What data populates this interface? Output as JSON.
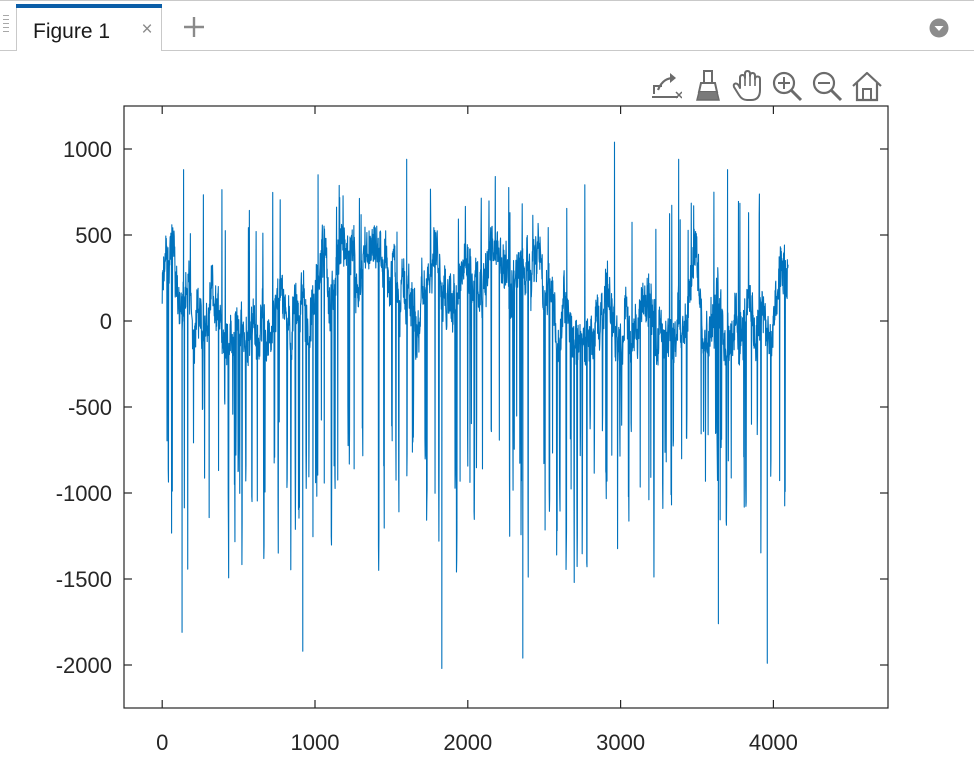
{
  "window": {
    "tab_title": "Figure 1",
    "close_glyph": "×",
    "add_tab_icon": "plus-icon",
    "menu_icon": "chevron-down-circle-icon"
  },
  "axes_toolbar": [
    {
      "name": "export-icon",
      "tooltip": "Export"
    },
    {
      "name": "brush-icon",
      "tooltip": "Brush/Select Data"
    },
    {
      "name": "pan-icon",
      "tooltip": "Pan"
    },
    {
      "name": "zoom-in-icon",
      "tooltip": "Zoom In"
    },
    {
      "name": "zoom-out-icon",
      "tooltip": "Zoom Out"
    },
    {
      "name": "home-icon",
      "tooltip": "Restore View"
    }
  ],
  "colors": {
    "line": "#0072bd",
    "axis": "#262626",
    "tab_accent": "#0b5ea8"
  },
  "chart_data": {
    "type": "line",
    "title": "",
    "xlabel": "",
    "ylabel": "",
    "xlim": [
      -250,
      4750
    ],
    "ylim": [
      -2250,
      1250
    ],
    "xticks": [
      0,
      1000,
      2000,
      3000,
      4000
    ],
    "yticks": [
      1000,
      500,
      0,
      -500,
      -1000,
      -1500,
      -2000
    ],
    "x_tick_labels": [
      "0",
      "1000",
      "2000",
      "3000",
      "4000"
    ],
    "y_tick_labels": [
      "1000",
      "500",
      "0",
      "-500",
      "-1000",
      "-1500",
      "-2000"
    ],
    "grid": false,
    "series": [
      {
        "x_start": 0,
        "x_end": 4096,
        "approx_points": 4096,
        "range": [
          -2020,
          1040
        ],
        "baseline_band": [
          -500,
          500
        ],
        "notable_peaks": [
          {
            "x": 140,
            "y": 880
          },
          {
            "x": 1020,
            "y": 850
          },
          {
            "x": 1600,
            "y": 940
          },
          {
            "x": 2180,
            "y": 840
          },
          {
            "x": 2960,
            "y": 1040
          },
          {
            "x": 3380,
            "y": 940
          },
          {
            "x": 3700,
            "y": 880
          }
        ],
        "notable_troughs": [
          {
            "x": 130,
            "y": -1810
          },
          {
            "x": 920,
            "y": -1920
          },
          {
            "x": 1830,
            "y": -2030
          },
          {
            "x": 2360,
            "y": -1960
          },
          {
            "x": 3640,
            "y": -1760
          },
          {
            "x": 3960,
            "y": -1990
          }
        ]
      }
    ]
  }
}
